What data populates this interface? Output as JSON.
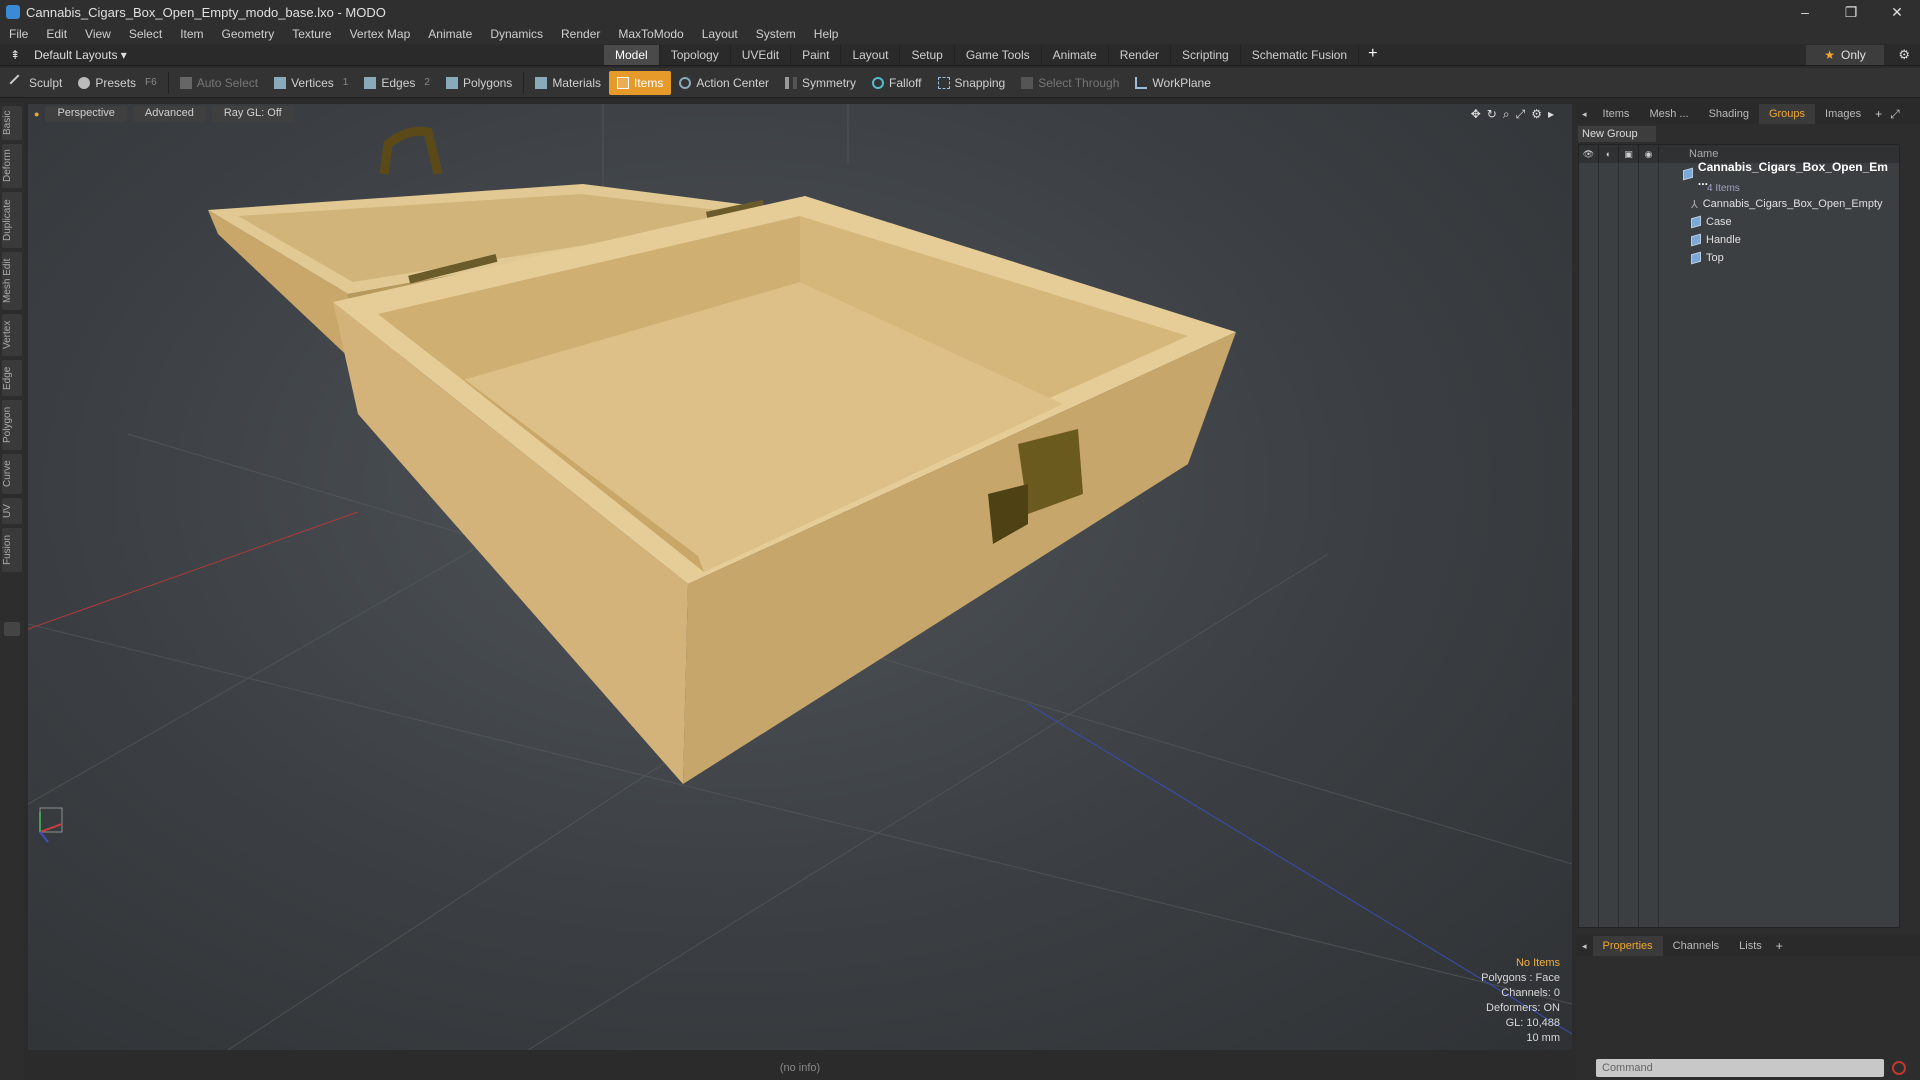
{
  "window": {
    "title": "Cannabis_Cigars_Box_Open_Empty_modo_base.lxo - MODO",
    "minimize": "–",
    "restore": "❐",
    "close": "✕"
  },
  "menu": [
    "File",
    "Edit",
    "View",
    "Select",
    "Item",
    "Geometry",
    "Texture",
    "Vertex Map",
    "Animate",
    "Dynamics",
    "Render",
    "MaxToModo",
    "Layout",
    "System",
    "Help"
  ],
  "layout": {
    "selector": "Default Layouts ▾",
    "tabs": [
      "Model",
      "Topology",
      "UVEdit",
      "Paint",
      "Layout",
      "Setup",
      "Game Tools",
      "Animate",
      "Render",
      "Scripting",
      "Schematic Fusion"
    ],
    "active_tab": "Model",
    "add": "+",
    "only": "Only"
  },
  "toolbar": {
    "sculpt": "Sculpt",
    "presets": "Presets",
    "presets_key": "F6",
    "auto_select": "Auto Select",
    "vertices": "Vertices",
    "vertices_key": "1",
    "edges": "Edges",
    "edges_key": "2",
    "polygons": "Polygons",
    "materials": "Materials",
    "items": "Items",
    "action_center": "Action Center",
    "symmetry": "Symmetry",
    "falloff": "Falloff",
    "snapping": "Snapping",
    "select_through": "Select Through",
    "workplane": "WorkPlane"
  },
  "side_tabs": [
    "Basic",
    "Deform",
    "Duplicate",
    "Mesh Edit",
    "Vertex",
    "Edge",
    "Polygon",
    "Curve",
    "UV",
    "Fusion"
  ],
  "viewport": {
    "view": "Perspective",
    "shading": "Advanced",
    "raygl": "Ray GL: Off",
    "info": {
      "no_items": "No Items",
      "polygons": "Polygons : Face",
      "channels": "Channels: 0",
      "deformers": "Deformers: ON",
      "gl": "GL: 10,488",
      "units": "10 mm"
    }
  },
  "status": "(no info)",
  "right_panel": {
    "tabs": [
      "Items",
      "Mesh ...",
      "Shading",
      "Groups",
      "Images"
    ],
    "active_tab": "Groups",
    "new_group": "New Group",
    "name_col": "Name",
    "root": "Cannabis_Cigars_Box_Open_Em ...",
    "root_count": "4 Items",
    "children": [
      "Cannabis_Cigars_Box_Open_Empty",
      "Case",
      "Handle",
      "Top"
    ]
  },
  "props_tabs": [
    "Properties",
    "Channels",
    "Lists"
  ],
  "props_active": "Properties",
  "command_placeholder": "Command",
  "colors": {
    "accent": "#e69a2a",
    "selected_tab": "#f0a830",
    "wood": "#d9b97a"
  }
}
